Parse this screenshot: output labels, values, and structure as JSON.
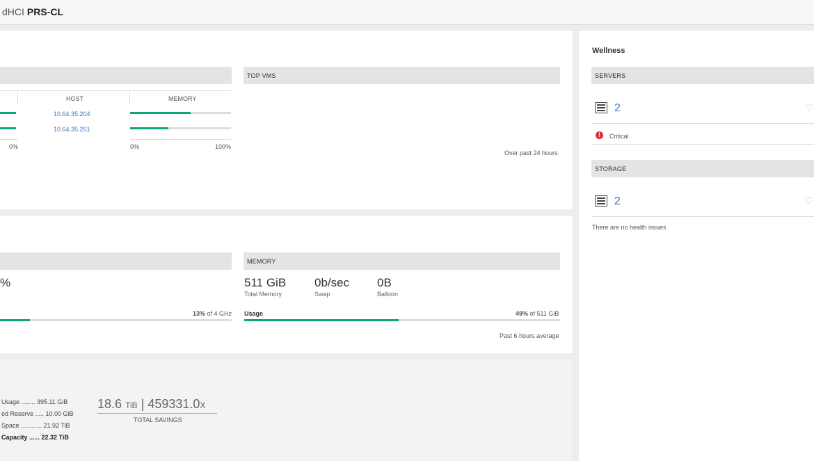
{
  "header": {
    "prefix": "dHCI",
    "cluster": "PRS-CL"
  },
  "top_left": {
    "col_host": "HOST",
    "col_memory": "MEMORY",
    "rows": [
      {
        "host": "10.64.35.204",
        "memory_fraction": 0.6,
        "cpu_fraction": 1.0
      },
      {
        "host": "10.64.35.251",
        "memory_fraction": 0.38,
        "cpu_fraction": 1.0
      }
    ],
    "axis_left_min": "0%",
    "axis_mem_min": "0%",
    "axis_mem_max": "100%"
  },
  "top_vms": {
    "title": "TOP VMS",
    "footer": "Over past 24 hours"
  },
  "cpu": {
    "value_fragment": "%",
    "usage_pct": "13%",
    "usage_suffix": " of 4 GHz",
    "usage_fraction": 0.13
  },
  "memory": {
    "title": "MEMORY",
    "total_value": "511 GiB",
    "total_label": "Total Memory",
    "swap_value": "0b/sec",
    "swap_label": "Swap",
    "balloon_value": "0B",
    "balloon_label": "Balloon",
    "usage_label": "Usage",
    "usage_pct": "49%",
    "usage_suffix": " of 511 GiB",
    "usage_fraction": 0.49,
    "footer": "Past 6 hours average"
  },
  "capacity": {
    "rows": [
      "Usage ........ 395.11 GiB",
      "ed Reserve ..... 10.00 GiB",
      "Space ............ 21.92 TiB",
      "Capacity ...... 22.32 TiB"
    ],
    "savings_value": "18.6",
    "savings_unit": "TiB",
    "savings_ratio": "459331.0",
    "savings_ratio_unit": "X",
    "savings_label": "TOTAL SAVINGS"
  },
  "wellness": {
    "title": "Wellness",
    "servers_title": "SERVERS",
    "servers_count": "2",
    "servers_status": "Critical",
    "storage_title": "STORAGE",
    "storage_count": "2",
    "storage_status": "There are no health issues"
  }
}
